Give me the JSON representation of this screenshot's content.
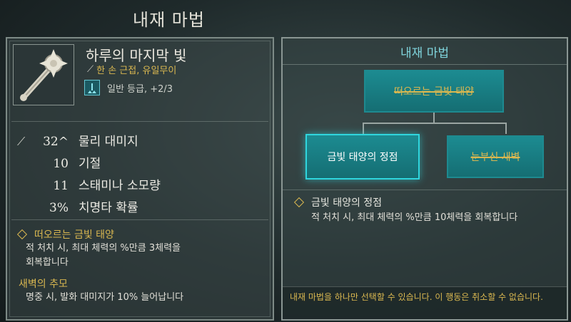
{
  "header": {
    "title": "내재 마법"
  },
  "weapon": {
    "name": "하루의 마지막 빛",
    "type": "한 손 근접, 유일무이",
    "grade": "일반 등급, +2/3"
  },
  "stats": [
    {
      "icon": "sword-icon",
      "value": "32^",
      "label": "물리 대미지"
    },
    {
      "icon": "",
      "value": "10",
      "label": "기절"
    },
    {
      "icon": "",
      "value": "11",
      "label": "스태미나 소모량"
    },
    {
      "icon": "",
      "value": "3%",
      "label": "치명타 확률"
    }
  ],
  "abilities": {
    "primary_title": "떠오르는 금빛 태양",
    "primary_desc": "적 처치 시, 최대 체력의 %만큼 3체력을",
    "primary_desc2": "회복합니다",
    "secondary_title": "새벽의 추모",
    "secondary_desc": "명중 시, 발화 대미지가 10% 늘어납니다"
  },
  "right": {
    "title": "내재 마법",
    "tree": {
      "top_node": "떠오르는 금빛 태양",
      "left_node": "금빛 태양의 정점",
      "right_node": "눈부신 새벽"
    },
    "selected_title": "금빛 태양의 정점",
    "selected_desc": "적 처치 시, 최대 체력의 %만큼 10체력을 회복합니다",
    "footer": "내재 마법을 하나만 선택할 수 있습니다. 이 행동은 취소할 수 없습니다."
  },
  "colors": {
    "gold": "#d9b750",
    "teal": "#1c8b91",
    "teal_glow": "#2fd6de"
  }
}
